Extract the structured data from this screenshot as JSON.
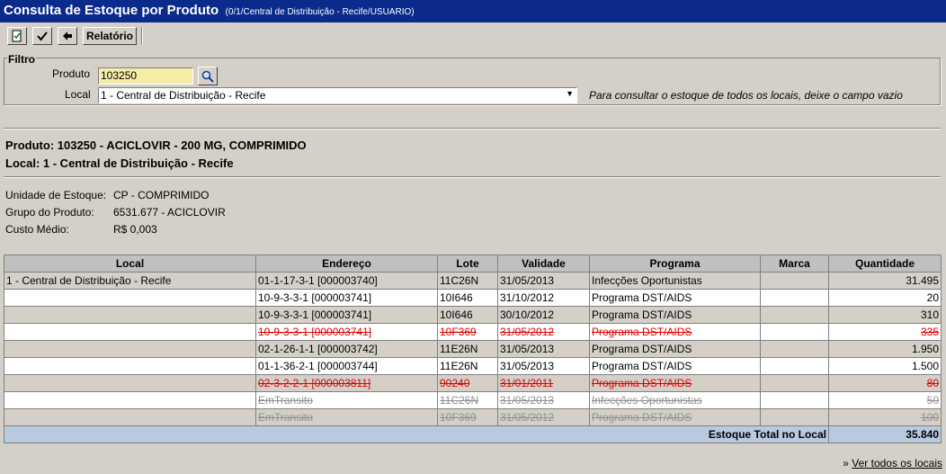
{
  "window": {
    "title": "Consulta de Estoque por Produto",
    "subtitle": "(0/1/Central de Distribuição - Recife/USUARIO)"
  },
  "toolbar": {
    "report_label": "Relatório"
  },
  "filter": {
    "legend": "Filtro",
    "product_label": "Produto",
    "product_value": "103250",
    "location_label": "Local",
    "location_value": "1 - Central de Distribuição - Recife",
    "hint": "Para consultar o estoque de todos os locais, deixe o campo vazio"
  },
  "summary": {
    "product_line": "Produto: 103250 - ACICLOVIR - 200 MG, COMPRIMIDO",
    "location_line": "Local: 1 - Central de Distribuição - Recife",
    "unit_label": "Unidade de Estoque:",
    "unit_value": "CP - COMPRIMIDO",
    "group_label": "Grupo do Produto:",
    "group_value": "6531.677 - ACICLOVIR",
    "cost_label": "Custo Médio:",
    "cost_value": "R$ 0,003"
  },
  "table": {
    "headers": [
      "Local",
      "Endereço",
      "Lote",
      "Validade",
      "Programa",
      "Marca",
      "Quantidade"
    ],
    "rows": [
      {
        "local": "1 - Central de Distribuição - Recife",
        "endereco": "01-1-17-3-1 [000003740]",
        "lote": "11C26N",
        "validade": "31/05/2013",
        "programa": "Infecções Oportunistas",
        "marca": "",
        "quantidade": "31.495",
        "style": "gray"
      },
      {
        "local": "",
        "endereco": "10-9-3-3-1 [000003741]",
        "lote": "10I646",
        "validade": "31/10/2012",
        "programa": "Programa DST/AIDS",
        "marca": "",
        "quantidade": "20",
        "style": "white"
      },
      {
        "local": "",
        "endereco": "10-9-3-3-1 [000003741]",
        "lote": "10I646",
        "validade": "30/10/2012",
        "programa": "Programa DST/AIDS",
        "marca": "",
        "quantidade": "310",
        "style": "gray"
      },
      {
        "local": "",
        "endereco": "10-9-3-3-1 [000003741]",
        "lote": "10F369",
        "validade": "31/05/2012",
        "programa": "Programa DST/AIDS",
        "marca": "",
        "quantidade": "335",
        "style": "white red"
      },
      {
        "local": "",
        "endereco": "02-1-26-1-1 [000003742]",
        "lote": "11E26N",
        "validade": "31/05/2013",
        "programa": "Programa DST/AIDS",
        "marca": "",
        "quantidade": "1.950",
        "style": "gray"
      },
      {
        "local": "",
        "endereco": "01-1-36-2-1 [000003744]",
        "lote": "11E26N",
        "validade": "31/05/2013",
        "programa": "Programa DST/AIDS",
        "marca": "",
        "quantidade": "1.500",
        "style": "white"
      },
      {
        "local": "",
        "endereco": "02-3-2-2-1 [000003811]",
        "lote": "90240",
        "validade": "31/01/2011",
        "programa": "Programa DST/AIDS",
        "marca": "",
        "quantidade": "80",
        "style": "gray red"
      },
      {
        "local": "",
        "endereco": "EmTransito",
        "lote": "11C26N",
        "validade": "31/05/2013",
        "programa": "Infecções Oportunistas",
        "marca": "",
        "quantidade": "50",
        "style": "white transit"
      },
      {
        "local": "",
        "endereco": "EmTransito",
        "lote": "10F369",
        "validade": "31/05/2012",
        "programa": "Programa DST/AIDS",
        "marca": "",
        "quantidade": "100",
        "style": "gray transit"
      }
    ],
    "total_label": "Estoque Total no Local",
    "total_value": "35.840"
  },
  "footer": {
    "link_prefix": "»",
    "link_label": "Ver todos os locais"
  },
  "colors": {
    "title_bar": "#0a2a8c",
    "window_bg": "#d4d0c8",
    "product_input_bg": "#f5eca8",
    "total_row_bg": "#b9c9e0",
    "expired_text": "#e00000"
  }
}
